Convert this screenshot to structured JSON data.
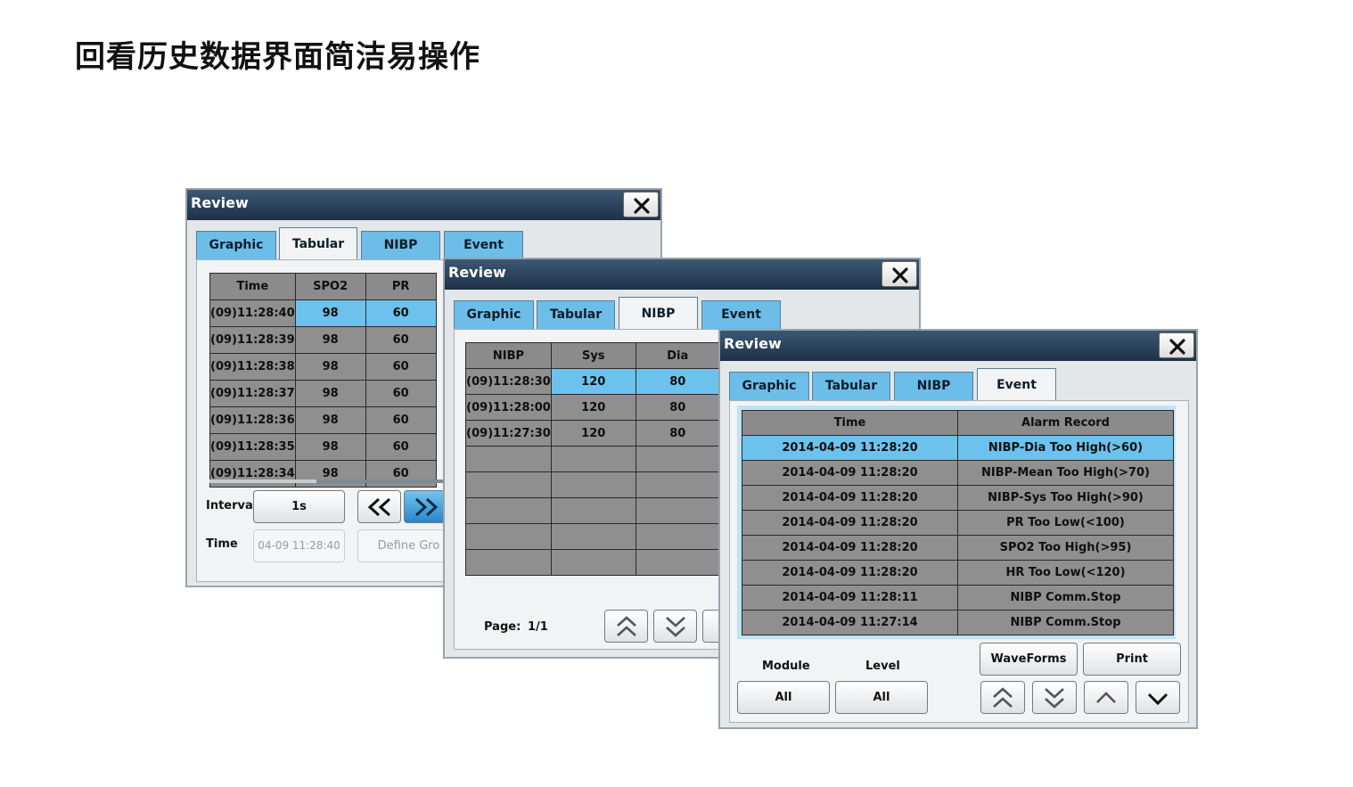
{
  "headline": "回看历史数据界面简洁易操作",
  "colors": {
    "accent": "#6cc2ec",
    "titlebar": "#1d3149",
    "panel": "#f1f3f4"
  },
  "window1": {
    "title": "Review",
    "tabs": [
      "Graphic",
      "Tabular",
      "NIBP",
      "Event"
    ],
    "active_tab": "Tabular",
    "columns": [
      "Time",
      "SPO2",
      "PR"
    ],
    "rows": [
      [
        "(09)11:28:40",
        "98",
        "60"
      ],
      [
        "(09)11:28:39",
        "98",
        "60"
      ],
      [
        "(09)11:28:38",
        "98",
        "60"
      ],
      [
        "(09)11:28:37",
        "98",
        "60"
      ],
      [
        "(09)11:28:36",
        "98",
        "60"
      ],
      [
        "(09)11:28:35",
        "98",
        "60"
      ],
      [
        "(09)11:28:34",
        "98",
        "60"
      ]
    ],
    "interval_label": "Interval",
    "interval_value": "1s",
    "time_label": "Time",
    "time_value": "04-09 11:28:40",
    "define_group_label": "Define Gro"
  },
  "window2": {
    "title": "Review",
    "tabs": [
      "Graphic",
      "Tabular",
      "NIBP",
      "Event"
    ],
    "active_tab": "NIBP",
    "columns": [
      "NIBP",
      "Sys",
      "Dia"
    ],
    "rows": [
      [
        "(09)11:28:30",
        "120",
        "80"
      ],
      [
        "(09)11:28:00",
        "120",
        "80"
      ],
      [
        "(09)11:27:30",
        "120",
        "80"
      ],
      [
        "",
        "",
        ""
      ],
      [
        "",
        "",
        ""
      ],
      [
        "",
        "",
        ""
      ],
      [
        "",
        "",
        ""
      ],
      [
        "",
        "",
        ""
      ]
    ],
    "page_label": "Page:",
    "page_value": "1/1"
  },
  "window3": {
    "title": "Review",
    "tabs": [
      "Graphic",
      "Tabular",
      "NIBP",
      "Event"
    ],
    "active_tab": "Event",
    "columns": [
      "Time",
      "Alarm Record"
    ],
    "rows": [
      [
        "2014-04-09 11:28:20",
        "NIBP-Dia Too High(>60)"
      ],
      [
        "2014-04-09 11:28:20",
        "NIBP-Mean Too High(>70)"
      ],
      [
        "2014-04-09 11:28:20",
        "NIBP-Sys Too High(>90)"
      ],
      [
        "2014-04-09 11:28:20",
        "PR Too Low(<100)"
      ],
      [
        "2014-04-09 11:28:20",
        "SPO2 Too High(>95)"
      ],
      [
        "2014-04-09 11:28:20",
        "HR Too Low(<120)"
      ],
      [
        "2014-04-09 11:28:11",
        "NIBP Comm.Stop"
      ],
      [
        "2014-04-09 11:27:14",
        "NIBP Comm.Stop"
      ]
    ],
    "module_label": "Module",
    "module_value": "All",
    "level_label": "Level",
    "level_value": "All",
    "waveforms_label": "WaveForms",
    "print_label": "Print"
  }
}
